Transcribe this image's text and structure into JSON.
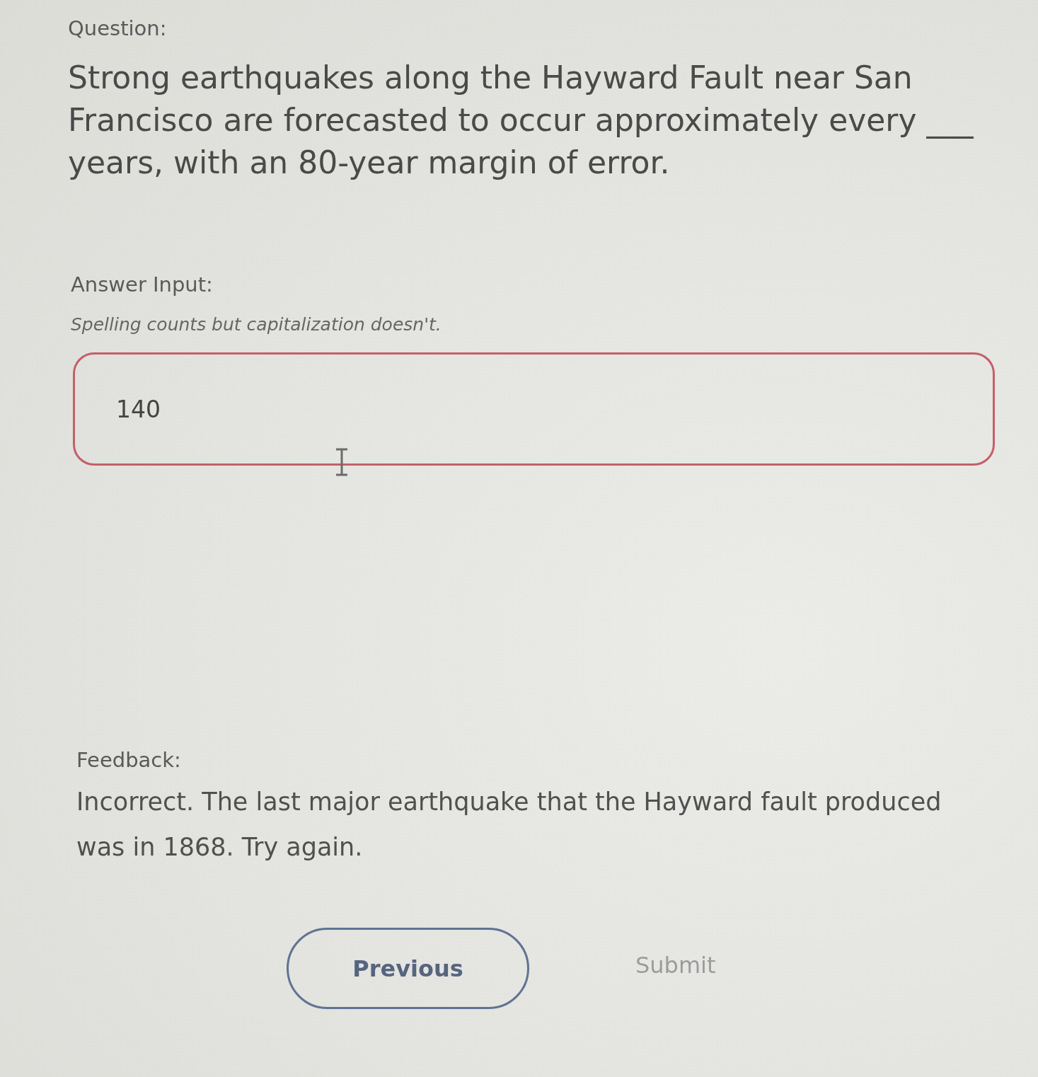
{
  "question": {
    "label": "Question:",
    "text": "Strong earthquakes along the Hayward Fault near San Francisco are forecasted to occur approximately every ___ years, with an 80-year margin of error."
  },
  "answer": {
    "label": "Answer Input:",
    "hint": "Spelling counts but capitalization doesn't.",
    "value": "140",
    "incorrect": true
  },
  "feedback": {
    "label": "Feedback:",
    "text": "Incorrect. The last major earthquake that the Hayward fault produced was in 1868. Try again."
  },
  "buttons": [
    {
      "label": "Previous",
      "kind": "outlined",
      "disabled": false
    },
    {
      "label": "Submit",
      "kind": "text",
      "disabled": true
    }
  ]
}
